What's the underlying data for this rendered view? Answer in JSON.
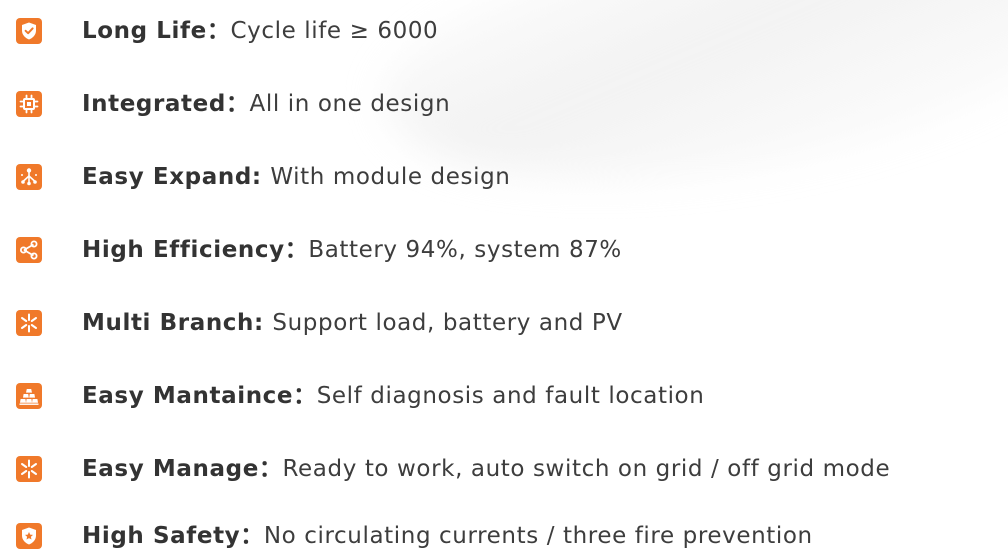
{
  "colors": {
    "accent": "#f0792a",
    "label_text": "#333333",
    "desc_text": "#3d3d3d"
  },
  "features": [
    {
      "icon": "shield-check-icon",
      "label": "Long Life",
      "separator": "：",
      "description": "Cycle life ≥ 6000"
    },
    {
      "icon": "chip-icon",
      "label": "Integrated",
      "separator": "：",
      "description": "All in one design"
    },
    {
      "icon": "network-expand-icon",
      "label": "Easy Expand",
      "separator": ": ",
      "description": "With module design"
    },
    {
      "icon": "share-nodes-icon",
      "label": "High Efficiency",
      "separator": "：",
      "description": "Battery 94%, system 87%"
    },
    {
      "icon": "branch-burst-icon",
      "label": "Multi Branch",
      "separator": ": ",
      "description": "Support load, battery and PV"
    },
    {
      "icon": "stacked-blocks-icon",
      "label": "Easy Mantaince",
      "separator": "：",
      "description": "Self diagnosis and fault location"
    },
    {
      "icon": "branch-burst-icon",
      "label": "Easy Manage",
      "separator": "：",
      "description": "Ready to work,  auto switch on grid / off grid mode"
    },
    {
      "icon": "shield-star-icon",
      "label": "High Safety",
      "separator": "：",
      "description": "No circulating currents / three fire prevention"
    }
  ]
}
